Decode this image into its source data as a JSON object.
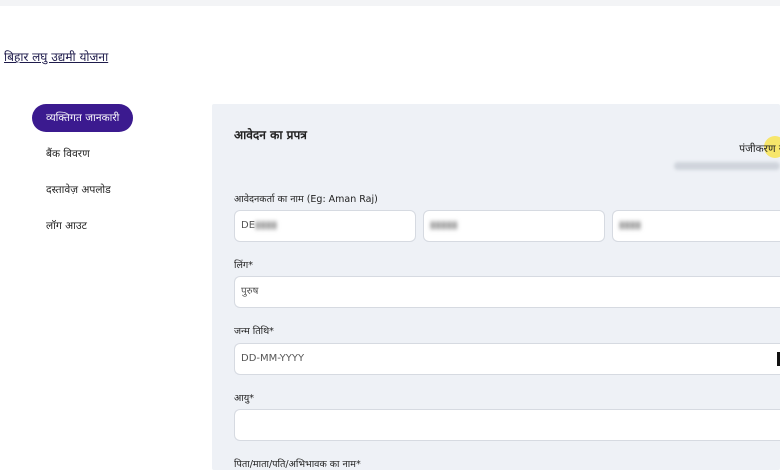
{
  "brand": {
    "title": "बिहार लघु उद्यमी योजना"
  },
  "sidebar": {
    "items": [
      {
        "label": "व्यक्तिगत जानकारी",
        "active": true
      },
      {
        "label": "बैंक विवरण",
        "active": false
      },
      {
        "label": "दस्तावेज़ अपलोड",
        "active": false
      },
      {
        "label": "लॉग आउट",
        "active": false
      }
    ]
  },
  "form": {
    "title": "आवेदन का प्रपत्र",
    "registration_label": "पंजीकरण सं",
    "fields": {
      "name": {
        "label": "आवेदनकर्ता का नाम (Eg: Aman Raj)",
        "first_value": "DE"
      },
      "gender": {
        "label": "लिंग*",
        "value": "पुरुष"
      },
      "dob": {
        "label": "जन्म तिथि*",
        "placeholder": "DD-MM-YYYY"
      },
      "age": {
        "label": "आयु*",
        "value": ""
      },
      "guardian": {
        "label": "पिता/माता/पति/अभिभावक का नाम*"
      }
    }
  },
  "colors": {
    "accent": "#3b1a8f",
    "panel_bg": "#eef1f6",
    "highlight": "#fae13c"
  }
}
